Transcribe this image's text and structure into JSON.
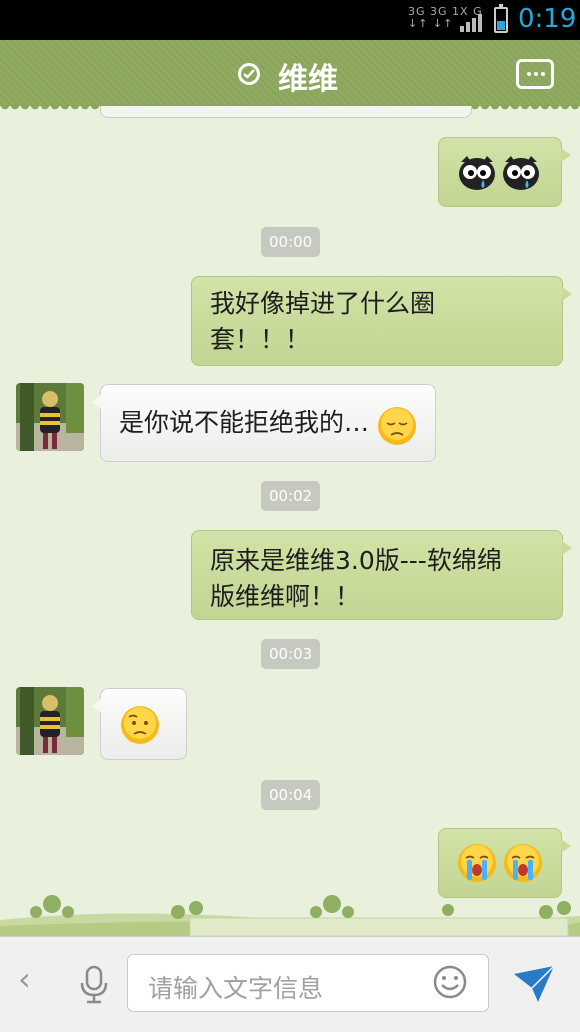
{
  "status": {
    "network": [
      "3G 3G 1X G",
      "↓↑ ↓↑"
    ],
    "time": "0:19"
  },
  "header": {
    "title": "维维"
  },
  "messages": [
    {
      "type": "emoji",
      "dir": "out",
      "icons": [
        "owl-cry-emoji",
        "owl-cry-emoji"
      ]
    },
    {
      "type": "time",
      "text": "00:00"
    },
    {
      "type": "text",
      "dir": "out",
      "lines": [
        "我好像掉进了什么圈",
        "套！！！"
      ]
    },
    {
      "type": "text",
      "dir": "in",
      "lines": [
        "是你说不能拒绝我的…"
      ],
      "trailing_icon": "sad-face-emoji"
    },
    {
      "type": "time",
      "text": "00:02"
    },
    {
      "type": "text",
      "dir": "out",
      "lines": [
        "原来是维维3.0版---软绵绵",
        "版维维啊！！"
      ]
    },
    {
      "type": "time",
      "text": "00:03"
    },
    {
      "type": "emoji",
      "dir": "in",
      "icons": [
        "confused-face-emoji"
      ]
    },
    {
      "type": "time",
      "text": "00:04"
    },
    {
      "type": "emoji",
      "dir": "out",
      "icons": [
        "crying-face-emoji",
        "crying-face-emoji"
      ]
    }
  ],
  "input": {
    "placeholder": "请输入文字信息"
  },
  "colors": {
    "header": "#8aa65a",
    "bubble_out": "#c8db9b",
    "time_accent": "#2aa7d6",
    "send": "#2a7ac8"
  }
}
